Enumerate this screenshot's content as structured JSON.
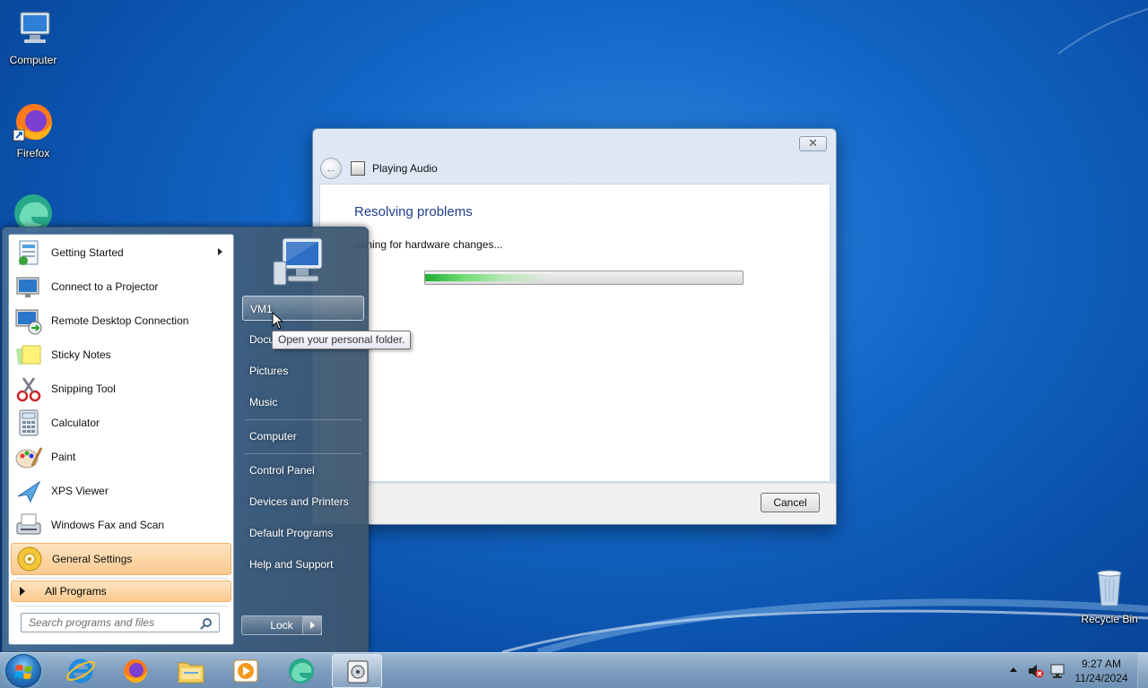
{
  "desktop": {
    "icons": [
      {
        "label": "Computer",
        "icon": "computer-icon"
      },
      {
        "label": "Firefox",
        "icon": "firefox-icon"
      },
      {
        "label": "Recycle Bin",
        "icon": "recycle-bin-icon"
      }
    ]
  },
  "troubleshooter": {
    "window_title": "Playing Audio",
    "heading": "Resolving problems",
    "status": "anning for hardware changes...",
    "progress": 0.25,
    "cancel_label": "Cancel",
    "close_glyph": "✕"
  },
  "start_menu": {
    "programs": [
      {
        "label": "Getting Started",
        "icon": "getting-started-icon",
        "submenu": true
      },
      {
        "label": "Connect to a Projector",
        "icon": "projector-icon"
      },
      {
        "label": "Remote Desktop Connection",
        "icon": "remote-desktop-icon"
      },
      {
        "label": "Sticky Notes",
        "icon": "sticky-notes-icon"
      },
      {
        "label": "Snipping Tool",
        "icon": "snipping-tool-icon"
      },
      {
        "label": "Calculator",
        "icon": "calculator-icon"
      },
      {
        "label": "Paint",
        "icon": "paint-icon"
      },
      {
        "label": "XPS Viewer",
        "icon": "xps-viewer-icon"
      },
      {
        "label": "Windows Fax and Scan",
        "icon": "fax-scan-icon"
      },
      {
        "label": "General Settings",
        "icon": "general-settings-icon",
        "highlighted": true
      }
    ],
    "all_programs_label": "All Programs",
    "search_placeholder": "Search programs and files",
    "right_links": {
      "user": "VM1",
      "documents": "Docu",
      "pictures": "Pictures",
      "music": "Music",
      "computer": "Computer",
      "control_panel": "Control Panel",
      "devices": "Devices and Printers",
      "default_programs": "Default Programs",
      "help": "Help and Support"
    },
    "lock_label": "Lock",
    "tooltip": "Open your personal folder."
  },
  "taskbar": {
    "pinned": [
      "internet-explorer-icon",
      "firefox-icon",
      "file-explorer-icon",
      "media-player-icon",
      "edge-icon",
      "troubleshooter-icon"
    ],
    "clock_time": "9:27 AM",
    "clock_date": "11/24/2024"
  }
}
